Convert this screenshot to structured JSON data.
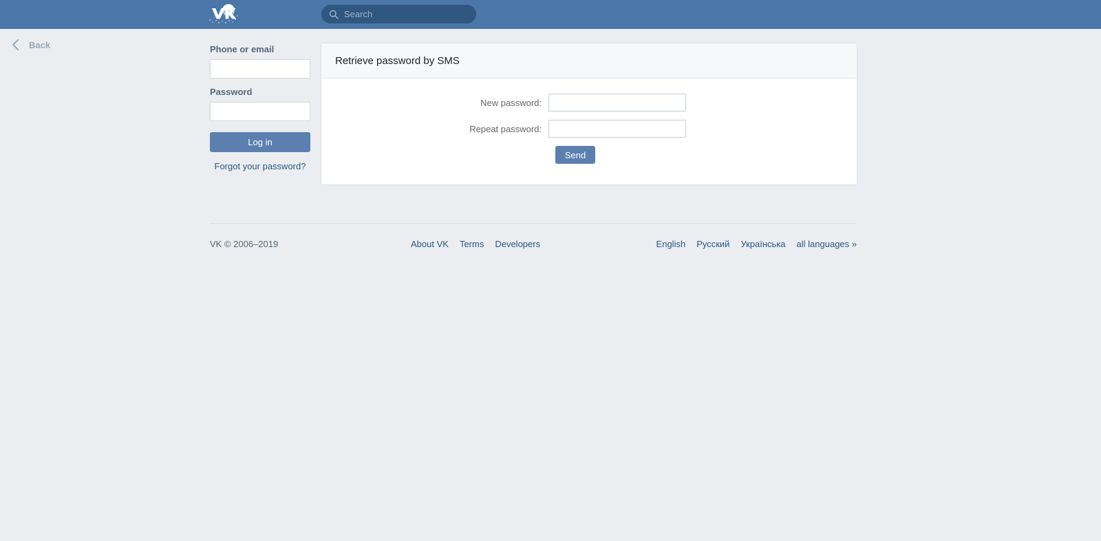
{
  "header": {
    "logo_icon": "vk-logo-winter-icon",
    "search": {
      "icon": "search-icon",
      "placeholder": "Search",
      "value": ""
    }
  },
  "back": {
    "icon": "chevron-left-icon",
    "label": "Back"
  },
  "login": {
    "phone_label": "Phone or email",
    "phone_value": "",
    "phone_placeholder": "",
    "password_label": "Password",
    "password_value": "",
    "password_placeholder": "",
    "login_button": "Log in",
    "forgot_link": "Forgot your password?"
  },
  "panel": {
    "title": "Retrieve password by SMS",
    "fields": [
      {
        "label": "New password:",
        "value": "",
        "placeholder": ""
      },
      {
        "label": "Repeat password:",
        "value": "",
        "placeholder": ""
      }
    ],
    "submit_label": "Send"
  },
  "footer": {
    "copyright": "VK © 2006–2019",
    "links": [
      {
        "label": "About VK"
      },
      {
        "label": "Terms"
      },
      {
        "label": "Developers"
      }
    ],
    "languages": [
      {
        "label": "English"
      },
      {
        "label": "Русский"
      },
      {
        "label": "Українська"
      },
      {
        "label": "all languages »"
      }
    ]
  },
  "colors": {
    "header_blue": "#4a76a8",
    "search_blue": "#2f577f",
    "button_blue": "#5b80b0",
    "link_blue": "#2a5885",
    "page_bg": "#ebedf0",
    "panel_header_bg": "#f7f8fa"
  }
}
